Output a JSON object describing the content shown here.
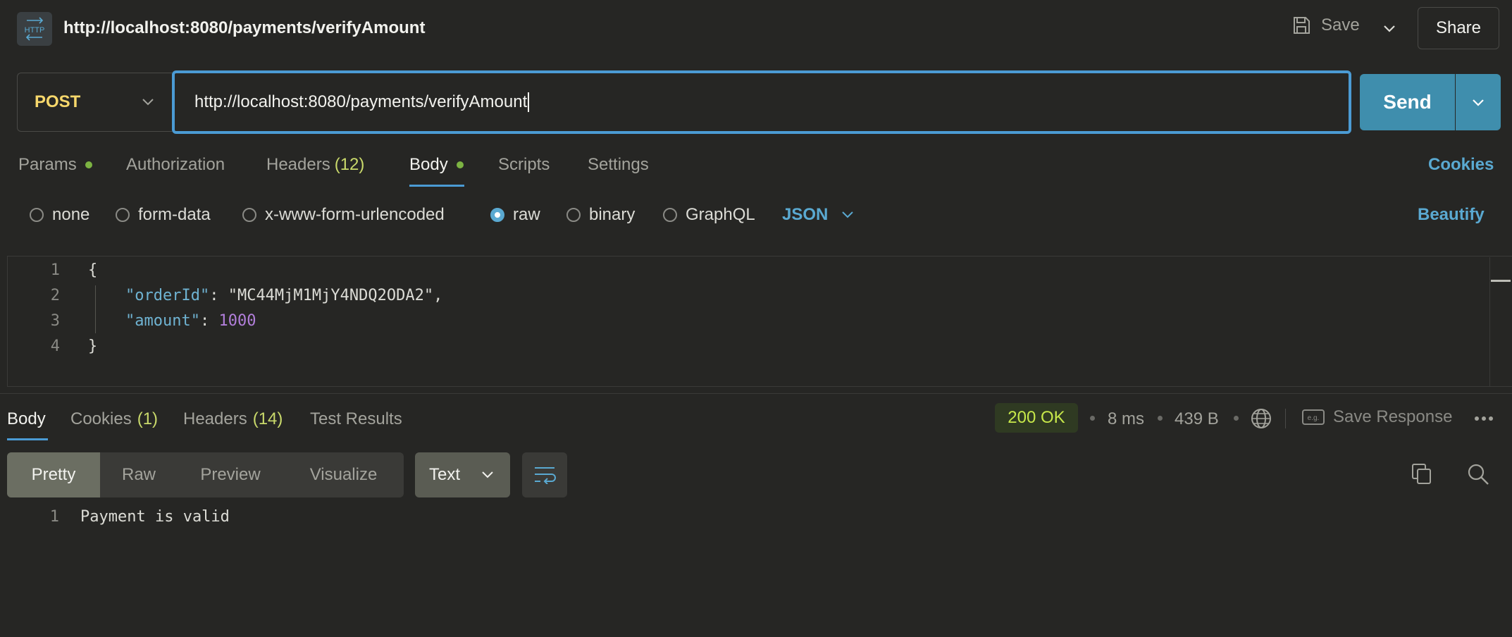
{
  "header": {
    "title": "http://localhost:8080/payments/verifyAmount",
    "icon_text": "HTTP",
    "save_label": "Save",
    "share_label": "Share"
  },
  "request": {
    "method": "POST",
    "url": "http://localhost:8080/payments/verifyAmount",
    "send_label": "Send"
  },
  "request_tabs": {
    "params": "Params",
    "authorization": "Authorization",
    "headers": "Headers",
    "headers_count": "(12)",
    "body": "Body",
    "scripts": "Scripts",
    "settings": "Settings",
    "cookies": "Cookies"
  },
  "body_types": {
    "none": "none",
    "form_data": "form-data",
    "urlencoded": "x-www-form-urlencoded",
    "raw": "raw",
    "binary": "binary",
    "graphql": "GraphQL",
    "selected": "raw",
    "format": "JSON",
    "beautify": "Beautify"
  },
  "editor": {
    "line_numbers": [
      "1",
      "2",
      "3",
      "4"
    ],
    "open_brace": "{",
    "order_key": "\"orderId\"",
    "order_value": "\"MC44MjM1MjY4NDQ2ODA2\"",
    "amount_key": "\"amount\"",
    "amount_value": "1000",
    "close_brace": "}"
  },
  "response_tabs": {
    "body": "Body",
    "cookies": "Cookies",
    "cookies_count": "(1)",
    "headers": "Headers",
    "headers_count": "(14)",
    "test_results": "Test Results"
  },
  "response_meta": {
    "status": "200 OK",
    "time": "8 ms",
    "size": "439 B",
    "save_response": "Save Response"
  },
  "response_toolbar": {
    "views": [
      "Pretty",
      "Raw",
      "Preview",
      "Visualize"
    ],
    "selected_view": "Pretty",
    "format": "Text"
  },
  "response_body": {
    "line_number": "1",
    "text": "Payment is valid"
  },
  "colors": {
    "background": "#262624",
    "accent": "#4b9bd4",
    "send_button": "#3f8ead",
    "method": "#f6d76b",
    "status_ok": "#c7e84a"
  }
}
